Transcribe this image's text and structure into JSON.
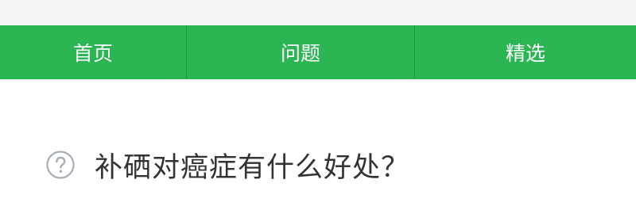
{
  "nav": {
    "items": [
      {
        "label": "首页"
      },
      {
        "label": "问题"
      },
      {
        "label": "精选"
      }
    ],
    "background": "#2bb553",
    "text_color": "#ffffff"
  },
  "question": {
    "icon": "question-circle-icon",
    "title": "补硒对癌症有什么好处？"
  }
}
